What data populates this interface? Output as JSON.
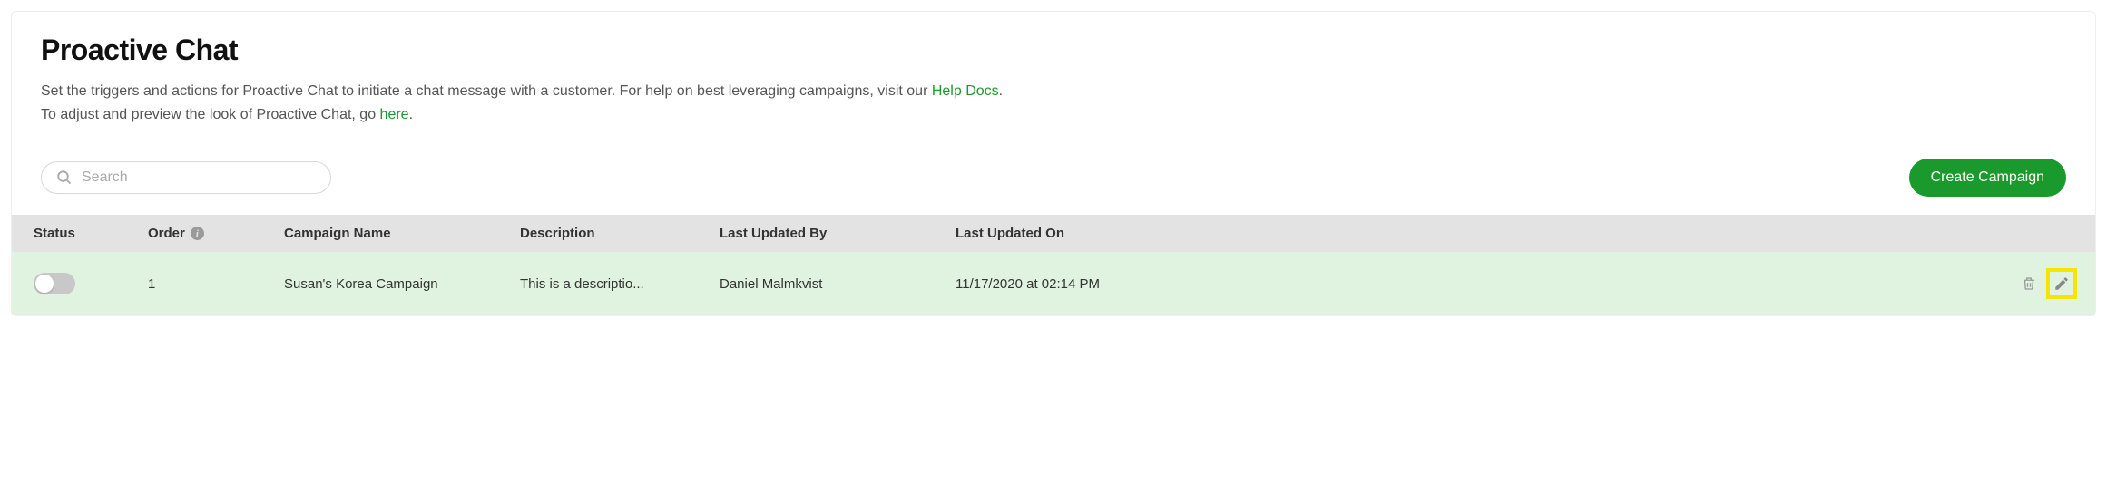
{
  "header": {
    "title": "Proactive Chat",
    "subtitle_part1": "Set the triggers and actions for Proactive Chat to initiate a chat message with a customer. For help on best leveraging campaigns, visit our ",
    "help_docs_link": "Help Docs",
    "subtitle_part2": ".",
    "subtitle_line2_part1": "To adjust and preview the look of Proactive Chat, go ",
    "here_link": "here",
    "subtitle_line2_part2": "."
  },
  "toolbar": {
    "search_placeholder": "Search",
    "create_label": "Create Campaign"
  },
  "table": {
    "headers": {
      "status": "Status",
      "order": "Order",
      "name": "Campaign Name",
      "description": "Description",
      "updated_by": "Last Updated By",
      "updated_on": "Last Updated On"
    },
    "rows": [
      {
        "order": "1",
        "name": "Susan's Korea Campaign",
        "description": "This is a descriptio...",
        "updated_by": "Daniel Malmkvist",
        "updated_on": "11/17/2020 at 02:14 PM"
      }
    ]
  }
}
